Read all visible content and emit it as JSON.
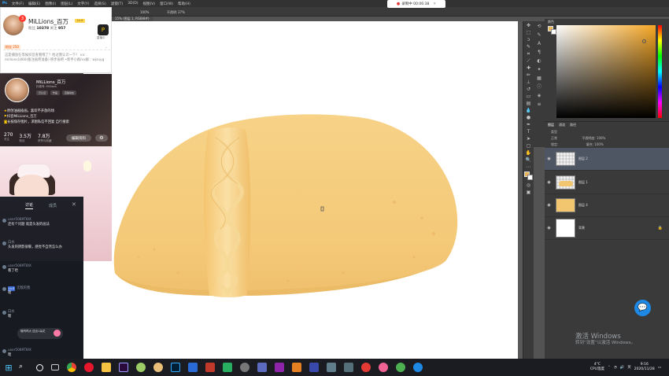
{
  "photoshop": {
    "menu": [
      "文件(F)",
      "编辑(E)",
      "图像(I)",
      "图层(L)",
      "文字(Y)",
      "选择(S)",
      "滤镜(T)",
      "3D(D)",
      "视图(V)",
      "窗口(W)",
      "帮助(H)"
    ],
    "options": {
      "zoom": "100%",
      "flow_label": "不透明:",
      "flow": "37%"
    },
    "doc_tab": "15% (图层 1, RGB/8#)",
    "color_panel_title": "颜色",
    "layers_tabs": [
      "图层",
      "通道",
      "路径"
    ],
    "blend_mode": "正常",
    "opacity_label": "不透明度:",
    "opacity": "100%",
    "lock_label": "锁定:",
    "fill_label": "填充:",
    "fill": "100%",
    "kind_label": "类型",
    "layers": [
      {
        "name": "图层 2",
        "thumb": "checker",
        "selected": true
      },
      {
        "name": "图层 1",
        "thumb": "gold",
        "selected": false
      },
      {
        "name": "图层 4",
        "thumb": "gold",
        "selected": false
      },
      {
        "name": "背景",
        "thumb": "white",
        "selected": false,
        "locked": true
      }
    ],
    "fg_color": "#E8B65A",
    "bg_color": "#FFFFFF"
  },
  "recorder": {
    "label": "录制中 00:06:38"
  },
  "profile": {
    "name": "MiLLions_百万",
    "badge_count": "3",
    "level": "Lv.4",
    "stats_prefix": "粉丝",
    "fans": "10378",
    "following_label": "关注",
    "following": "957",
    "button_label": "直播中",
    "tag": "粉丝 250",
    "tip": "这是播放在等候抖音查看哦了？给过我认识一下！ vx: millions1860(备注画吧准备) 移步画吧 •新手小群/vx群：wjsuyg"
  },
  "douyin": {
    "name": "MiLLions_百万",
    "sub": "抖音号: Millions",
    "pills": [
      "已认证",
      "作品",
      "直播动态"
    ],
    "bio": [
      "原创油画插画，喜欢不开放的场",
      "抖音MiLLions_百万",
      "长按保存图片，求图私信不回复 自行搜索"
    ],
    "nums": [
      {
        "v": "270",
        "l": "关注"
      },
      {
        "v": "3.5万",
        "l": "粉丝"
      },
      {
        "v": "7.8万",
        "l": "获赞与收藏"
      }
    ],
    "edit": "编辑资料"
  },
  "chat": {
    "tabs": [
      "讨论",
      "成员"
    ],
    "messages": [
      {
        "who": "user5089T8IX",
        "text": "还有个问题 就是头发的画法"
      },
      {
        "who": "白水",
        "text": "头发的阴影很暖，感觉不自然怎么办"
      },
      {
        "who": "user5089T8IX",
        "text": "看了哈"
      },
      {
        "who": "无敌的我",
        "lv": "Lv.5",
        "text": "嗯"
      },
      {
        "who": "白水",
        "text": "嗯"
      },
      {
        "who": "user5089T8IX",
        "text": "嗯"
      }
    ],
    "gift_text": "哦呜呜大 送出1朵花"
  },
  "watermark": {
    "line1": "激活 Windows",
    "line2": "转到“设置”以激活 Windows。"
  },
  "taskbar": {
    "weather": "4°C",
    "weather_sub": "CPU温度",
    "time": "9:16",
    "date": "2020/11/28",
    "ime": "英"
  }
}
